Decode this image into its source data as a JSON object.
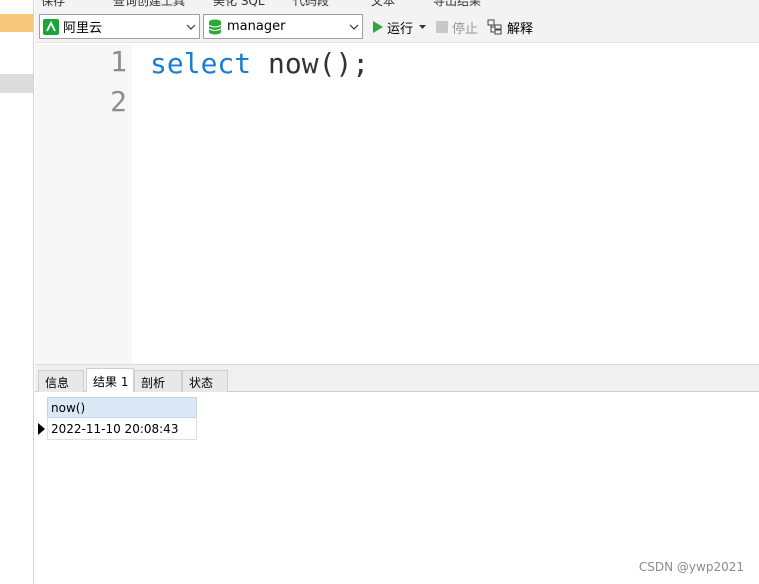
{
  "toolbar_top": {
    "fragments": [
      "保存",
      "查询创建工具",
      "美化 SQL",
      "代码段",
      "文本",
      "导出结果"
    ]
  },
  "connection": {
    "value": "阿里云",
    "icon": "connection-icon"
  },
  "database": {
    "value": "manager",
    "icon": "database-icon"
  },
  "actions": {
    "run_label": "运行",
    "stop_label": "停止",
    "explain_label": "解释"
  },
  "editor": {
    "line_numbers": [
      "1",
      "2"
    ],
    "code_keyword": "select",
    "code_rest": " now();"
  },
  "tabs": {
    "info": "信息",
    "result": "结果 1",
    "profile": "剖析",
    "status": "状态"
  },
  "result": {
    "columns": [
      "now()"
    ],
    "rows": [
      [
        "2022-11-10 20:08:43"
      ]
    ]
  },
  "watermark": "CSDN @ywp2021",
  "colors": {
    "keyword": "#1a7fd4",
    "run_icon": "#2fa83a",
    "header_bg": "#dbe8f6"
  }
}
